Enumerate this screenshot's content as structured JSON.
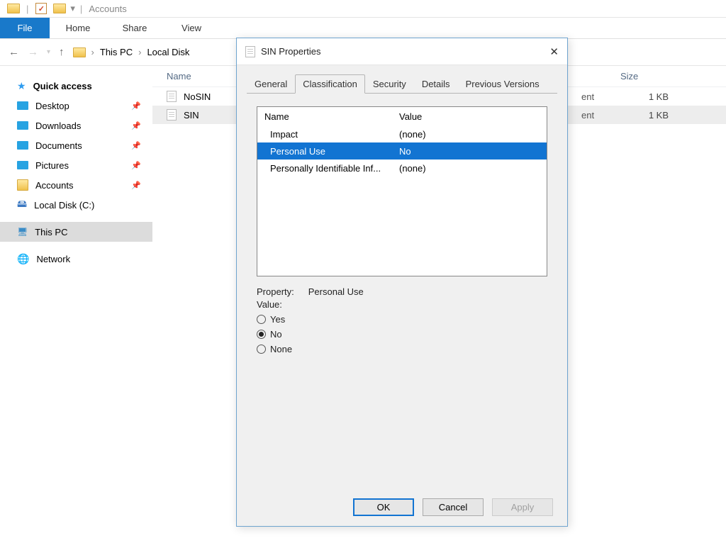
{
  "window": {
    "title": "Accounts"
  },
  "ribbon": {
    "file": "File",
    "tabs": [
      "Home",
      "Share",
      "View"
    ]
  },
  "breadcrumb": [
    "This PC",
    "Local Disk"
  ],
  "columns": {
    "name": "Name",
    "size": "Size"
  },
  "sidebar": {
    "quick_access": "Quick access",
    "items": [
      "Desktop",
      "Downloads",
      "Documents",
      "Pictures",
      "Accounts"
    ],
    "local_disk": "Local Disk (C:)",
    "this_pc": "This PC",
    "network": "Network"
  },
  "files": [
    {
      "name": "NoSIN",
      "type": "ent",
      "size": "1 KB"
    },
    {
      "name": "SIN",
      "type": "ent",
      "size": "1 KB"
    }
  ],
  "dialog": {
    "title": "SIN Properties",
    "tabs": [
      "General",
      "Classification",
      "Security",
      "Details",
      "Previous Versions"
    ],
    "active_tab": "Classification",
    "list_headers": {
      "name": "Name",
      "value": "Value"
    },
    "props": [
      {
        "name": "Impact",
        "value": "(none)"
      },
      {
        "name": "Personal Use",
        "value": "No"
      },
      {
        "name": "Personally Identifiable Inf...",
        "value": "(none)"
      }
    ],
    "selected_index": 1,
    "property_label": "Property:",
    "property_value": "Personal Use",
    "value_label": "Value:",
    "radios": [
      "Yes",
      "No",
      "None"
    ],
    "radio_selected": "No",
    "buttons": {
      "ok": "OK",
      "cancel": "Cancel",
      "apply": "Apply"
    }
  }
}
